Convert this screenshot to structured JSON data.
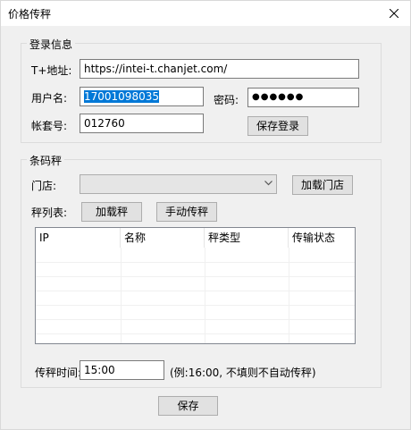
{
  "window": {
    "title": "价格传秤"
  },
  "login_group": {
    "legend": "登录信息",
    "address_label": "T+地址:",
    "address_value": "https://intei-t.chanjet.com/",
    "username_label": "用户名:",
    "username_value": "17001098035",
    "password_label": "密码:",
    "password_value": "●●●●●●",
    "account_label": "帐套号:",
    "account_value": "012760",
    "login_button": "保存登录"
  },
  "scale_group": {
    "legend": "条码秤",
    "store_label": "门店:",
    "store_value": "",
    "load_store_button": "加载门店",
    "scale_list_label": "秤列表:",
    "load_scale_button": "加载秤",
    "manual_transfer_button": "手动传秤",
    "table": {
      "columns": [
        "IP",
        "名称",
        "秤类型",
        "传输状态"
      ],
      "rows": []
    },
    "transfer_time_label": "传秤时间:",
    "transfer_time_value": "15:00",
    "transfer_time_hint": "(例:16:00, 不填则不自动传秤)"
  },
  "footer": {
    "save_button": "保存"
  },
  "colors": {
    "selection": "#0078d7",
    "window_bg": "#f0f0f0"
  },
  "icons": {
    "close": "close-icon",
    "dropdown": "chevron-down-icon"
  }
}
